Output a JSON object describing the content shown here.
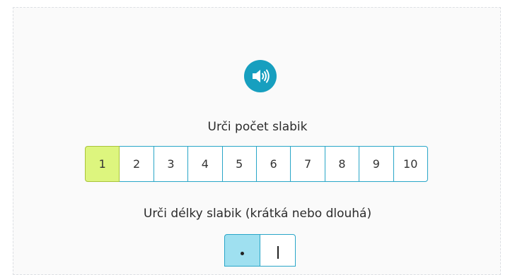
{
  "audio": {
    "icon": "speaker-icon",
    "color": "#179fbf"
  },
  "syllable_count": {
    "prompt": "Urči počet slabik",
    "options": [
      "1",
      "2",
      "3",
      "4",
      "5",
      "6",
      "7",
      "8",
      "9",
      "10"
    ],
    "selected": "1",
    "selected_color": "#ddf57e"
  },
  "syllable_length": {
    "prompt": "Urči délky slabik (krátká nebo dlouhá)",
    "options": [
      {
        "name": "short",
        "icon": "dot-icon",
        "selected": true
      },
      {
        "name": "long",
        "icon": "bar-icon",
        "selected": false
      }
    ],
    "selected_color": "#9fe0f0"
  },
  "accent_color": "#29a6c8"
}
